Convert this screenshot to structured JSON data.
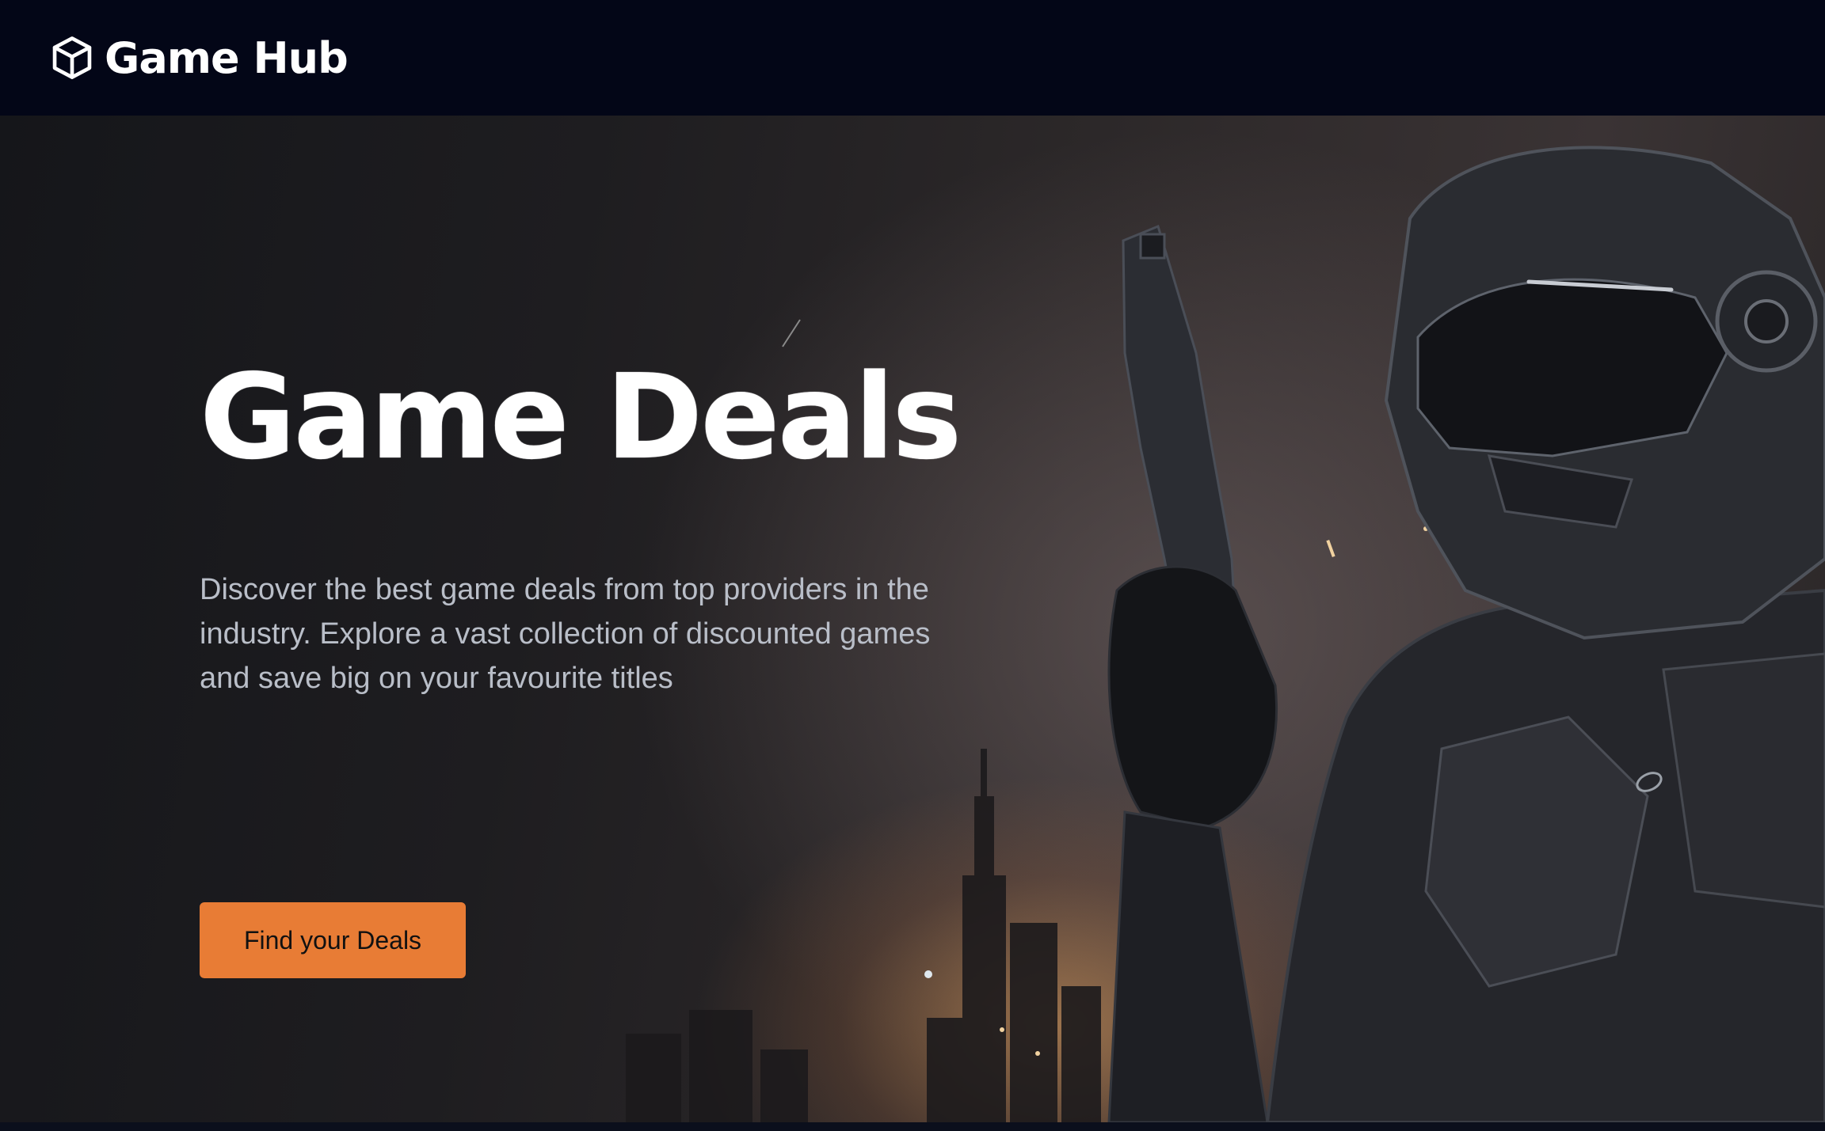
{
  "navbar": {
    "brand_name": "Game Hub",
    "brand_icon": "cube-icon"
  },
  "hero": {
    "title": "Game Deals",
    "description": "Discover the best game deals from top providers in the industry. Explore a vast collection of discounted games and save big on your favourite titles",
    "cta_label": "Find your Deals",
    "background_image": "armored-soldier-with-pistol-city-explosion"
  },
  "colors": {
    "navbar_bg": "#030617",
    "cta_bg": "#e87c35",
    "title_text": "#ffffff",
    "description_text": "#b9bec8"
  }
}
